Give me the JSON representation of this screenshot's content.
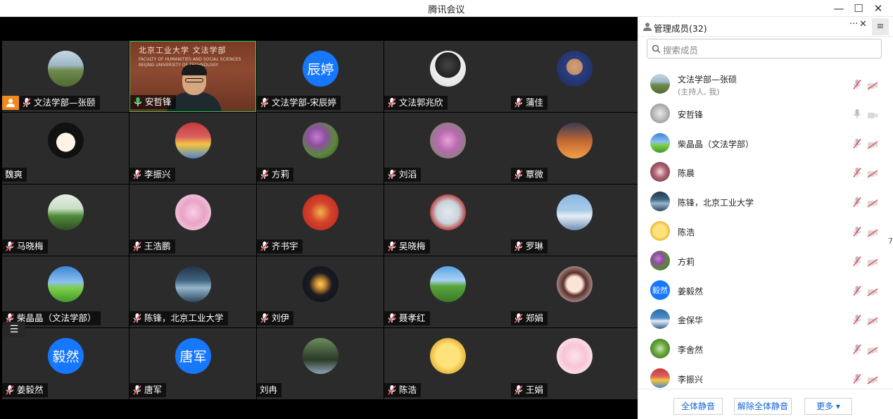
{
  "window": {
    "title": "腾讯会议",
    "minimize": "—",
    "maximize": "☐",
    "close": "✕"
  },
  "grid": {
    "list_toggle": "☰",
    "tiles": [
      {
        "name": "文法学部—张颐",
        "avatar": "photo-field",
        "host": true,
        "mic": "muted"
      },
      {
        "name": "安哲锋",
        "avatar": "video-speaker",
        "active": true,
        "mic": "speaking"
      },
      {
        "name": "文法学部-宋辰婷",
        "avatar_text": "辰婷",
        "mic": "muted"
      },
      {
        "name": "文法郭兆欣",
        "avatar": "photo-figure-dark",
        "mic": "muted"
      },
      {
        "name": "蒲佳",
        "avatar": "photo-person-kid",
        "mic": "muted"
      },
      {
        "name": "魏爽",
        "avatar": "photo-cartoon-girl",
        "mic": "none"
      },
      {
        "name": "李振兴",
        "avatar": "photo-stadium",
        "mic": "muted"
      },
      {
        "name": "方莉",
        "avatar": "photo-purple-flowers",
        "mic": "muted"
      },
      {
        "name": "刘滔",
        "avatar": "photo-pink-flowers",
        "mic": "muted"
      },
      {
        "name": "覃微",
        "avatar": "photo-sunset-silhouette",
        "mic": "muted"
      },
      {
        "name": "马晓梅",
        "avatar": "photo-sprouts",
        "mic": "muted"
      },
      {
        "name": "王浩鹏",
        "avatar": "photo-cartoon-pink",
        "mic": "muted"
      },
      {
        "name": "齐书宇",
        "avatar": "photo-tiger-2022",
        "mic": "muted"
      },
      {
        "name": "吴晓梅",
        "avatar": "photo-anime",
        "mic": "muted"
      },
      {
        "name": "罗琳",
        "avatar": "photo-mountains",
        "mic": "muted"
      },
      {
        "name": "柴晶晶（文法学部）",
        "avatar": "photo-meadow-sky",
        "mic": "muted"
      },
      {
        "name": "陈锋，北京工业大学",
        "avatar": "photo-building",
        "mic": "muted"
      },
      {
        "name": "刘伊",
        "avatar": "photo-fireworks",
        "mic": "muted"
      },
      {
        "name": "聂孝红",
        "avatar": "photo-grassland",
        "mic": "muted"
      },
      {
        "name": "郑娟",
        "avatar": "photo-cartoon-glasses",
        "mic": "muted"
      },
      {
        "name": "姜毅然",
        "avatar_text": "毅然",
        "mic": "muted"
      },
      {
        "name": "唐军",
        "avatar_text": "唐军",
        "mic": "muted"
      },
      {
        "name": "刘冉",
        "avatar": "photo-bridge",
        "mic": "none"
      },
      {
        "name": "陈浩",
        "avatar": "photo-cartoon-face",
        "mic": "muted"
      },
      {
        "name": "王娟",
        "avatar": "photo-cartoon-girl2",
        "mic": "muted"
      }
    ],
    "speaker_sign": {
      "line1": "北京工业大学 文法学部",
      "line2": "FACULTY OF HUMANITIES AND SOCIAL SCIENCES",
      "line3": "BEIJING UNIVERSITY OF TECHNOLOGY"
    }
  },
  "panel": {
    "title": "管理成员(32)",
    "more": "···",
    "close": "✕",
    "menu": "≡",
    "search_placeholder": "搜索成员",
    "members": [
      {
        "name": "文法学部—张硕",
        "sub": "(主持人, 我)",
        "avatar": "photo-field",
        "mic": "muted"
      },
      {
        "name": "安哲锋",
        "avatar": "photo-coin",
        "mic": "on"
      },
      {
        "name": "柴晶晶（文法学部）",
        "avatar": "photo-meadow-sky",
        "mic": "muted"
      },
      {
        "name": "陈晨",
        "avatar": "photo-anime-maroon",
        "mic": "muted"
      },
      {
        "name": "陈锋，北京工业大学",
        "avatar": "photo-building",
        "mic": "muted"
      },
      {
        "name": "陈浩",
        "avatar": "photo-cartoon-face",
        "mic": "muted"
      },
      {
        "name": "方莉",
        "avatar": "photo-purple-flowers",
        "mic": "muted"
      },
      {
        "name": "姜毅然",
        "avatar_text": "毅然",
        "mic": "muted"
      },
      {
        "name": "金保华",
        "avatar": "photo-swans",
        "mic": "muted"
      },
      {
        "name": "李舍然",
        "avatar": "photo-green-leaf",
        "mic": "muted"
      },
      {
        "name": "李振兴",
        "avatar": "photo-stadium",
        "mic": "muted"
      }
    ],
    "footer": {
      "mute_all": "全体静音",
      "unmute_all": "解除全体静音",
      "more": "更多 ▾"
    }
  },
  "colors": {
    "host_badge": "#f08a1c",
    "active_border": "#2ecb56",
    "avatar_blue": "#1677ff",
    "muted_red": "#e8505b",
    "button_text": "#1565d8"
  },
  "misc": {
    "edge_mark": "7"
  }
}
